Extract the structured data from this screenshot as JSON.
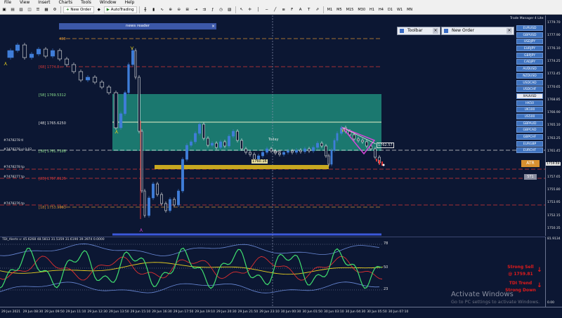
{
  "menu": [
    "File",
    "View",
    "Insert",
    "Charts",
    "Tools",
    "Window",
    "Help"
  ],
  "toolbar": {
    "new_order": "New Order",
    "autotrading": "AutoTrading",
    "timeframes": [
      "M1",
      "M5",
      "M15",
      "M30",
      "H1",
      "H4",
      "D1",
      "W1",
      "MN"
    ]
  },
  "news_reader": {
    "title": "news reader",
    "close": "×"
  },
  "panels": {
    "toolbar": "Toolbar",
    "new_order": "New Order",
    "close": "×"
  },
  "trade_manager": {
    "title": "Trade Manager 4 Lite",
    "symbols": [
      "EURUSD",
      "GBPUSD",
      "USDJPY",
      "EURJPY",
      "GBPJPY",
      "CADJPY",
      "AUDUSD",
      "NZDUSD",
      "USDCAD",
      "USDCHF",
      "XAUUSD",
      "HK50",
      "UK100",
      "US500",
      "GBPAUD",
      "GBPCAD",
      "GBPCHF",
      "EURGBP",
      "EURCHF"
    ],
    "selected": "XAUUSD",
    "atr": "ATR",
    "st1": "ST1"
  },
  "chart": {
    "today": "Today",
    "open": "Open",
    "level_438": "438",
    "levels": [
      {
        "label": "[68] 1774.8…",
        "color": "#d83838"
      },
      {
        "label": "[58] 1769.5312",
        "color": "#8ce08c"
      },
      {
        "label": "[48] 1765.6250",
        "color": "#e0e0e0"
      },
      {
        "label": "[38] 1761.7188",
        "color": "#8ce08c"
      },
      {
        "label": "[28] 1757.8125",
        "color": "#d83838"
      },
      {
        "label": "[18] 1753.9063",
        "color": "#d89030"
      }
    ],
    "orders": [
      "#7478278 tl",
      "#7478278 sl 0.02",
      "#7478278 tp",
      "#7478277 tp",
      "#7478276 tp"
    ],
    "box_price": "1760.16",
    "right_price": "1762.57",
    "current_price": "1759.48"
  },
  "price_axis": [
    "1779.70",
    "1777.90",
    "1776.10",
    "1774.25",
    "1772.45",
    "1770.65",
    "1768.85",
    "1766.90",
    "1765.10",
    "1763.25",
    "1761.45",
    "1759.55",
    "1757.65",
    "1755.80",
    "1753.95",
    "1752.15",
    "1750.35"
  ],
  "indicator": {
    "label": "TDI_Alerts v: 45.6268 48.5813 31.5359 31.6190 39.3974 0.0000",
    "axis": [
      "78",
      "50",
      "23"
    ],
    "axis_top": "81.9134",
    "axis_bottom": "0.00"
  },
  "signals": {
    "strong_sell": "Strong Sell",
    "sell_price": "@ 1759.81",
    "tdi_trend": "TDI Trend",
    "strong_down": "Strong Down"
  },
  "time_axis": [
    "29 Jun 2021",
    "29 Jun 08:30",
    "29 Jun 09:50",
    "29 Jun 11:10",
    "29 Jun 12:30",
    "29 Jun 13:50",
    "29 Jun 15:10",
    "29 Jun 16:30",
    "29 Jun 17:50",
    "29 Jun 19:10",
    "29 Jun 20:30",
    "29 Jun 21:50",
    "29 Jun 23:10",
    "30 Jun 00:30",
    "30 Jun 01:50",
    "30 Jun 03:10",
    "30 Jun 04:30",
    "30 Jun 05:50",
    "30 Jun 07:10"
  ],
  "watermark": {
    "title": "Activate Windows",
    "subtitle": "Go to PC settings to activate Windows."
  },
  "colors": {
    "background": "#0c1733",
    "zone": "#1f8a7a",
    "bull": "#3f7dd8",
    "bear": "#e8e8e8",
    "yellow_box": "#c8a820"
  }
}
